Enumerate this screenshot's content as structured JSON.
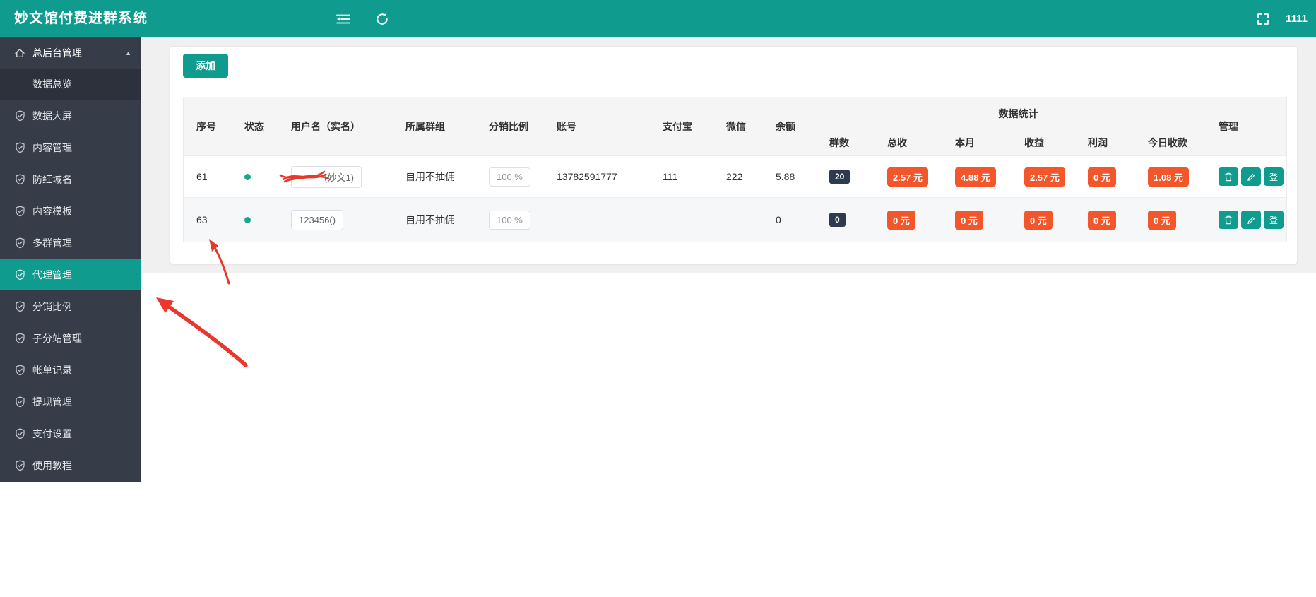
{
  "header": {
    "title": "妙文馆付费进群系统",
    "username": "1111"
  },
  "sidebar": {
    "parent_label": "总后台管理",
    "overview_label": "数据总览",
    "items": [
      {
        "label": "数据大屏"
      },
      {
        "label": "内容管理"
      },
      {
        "label": "防红域名"
      },
      {
        "label": "内容模板"
      },
      {
        "label": "多群管理"
      },
      {
        "label": "代理管理",
        "active": true
      },
      {
        "label": "分销比例"
      },
      {
        "label": "子分站管理"
      },
      {
        "label": "帐单记录"
      },
      {
        "label": "提现管理"
      },
      {
        "label": "支付设置"
      },
      {
        "label": "使用教程"
      }
    ]
  },
  "toolbar": {
    "add_label": "添加"
  },
  "table": {
    "columns": [
      "序号",
      "状态",
      "用户名（实名）",
      "所属群组",
      "分销比例",
      "账号",
      "支付宝",
      "微信",
      "余额",
      "群数",
      "总收",
      "本月",
      "收益",
      "利润",
      "今日收款",
      "管理"
    ],
    "group_label": "数据统计",
    "login_label": "登",
    "rows": [
      {
        "seq": "61",
        "status": "online",
        "username": "(妙文1)",
        "username_redacted": true,
        "group": "自用不抽佣",
        "ratio": "100 %",
        "account": "13782591777",
        "alipay": "111",
        "wechat": "222",
        "balance": "5.88",
        "group_count": "20",
        "total_income": "2.57 元",
        "month_income": "4.88 元",
        "income": "2.57 元",
        "profit": "0 元",
        "today_income": "1.08 元"
      },
      {
        "seq": "63",
        "status": "online",
        "username": "123456()",
        "username_redacted": false,
        "group": "自用不抽佣",
        "ratio": "100 %",
        "account": "",
        "alipay": "",
        "wechat": "",
        "balance": "0",
        "group_count": "0",
        "total_income": "0 元",
        "month_income": "0 元",
        "income": "0 元",
        "profit": "0 元",
        "today_income": "0 元"
      }
    ]
  },
  "icons": {
    "topbar": [
      "menu-fold-icon",
      "refresh-icon",
      "fullscreen-icon"
    ],
    "sidebar": [
      "home-icon",
      "chevron-up-icon",
      "shield-check-icon"
    ],
    "row_actions": [
      "trash-icon",
      "pencil-icon"
    ],
    "status": "green-dot"
  },
  "colors": {
    "accent_teal": "#0F9B8E",
    "sidebar_bg": "#363D49",
    "sidebar_submenu_bg": "#2C313C",
    "badge_red": "#F4562B",
    "badge_navy": "#2E3B4E",
    "status_green": "#15A98B",
    "annotation_red": "#E8372C",
    "table_header_bg": "#F5F5F5"
  }
}
